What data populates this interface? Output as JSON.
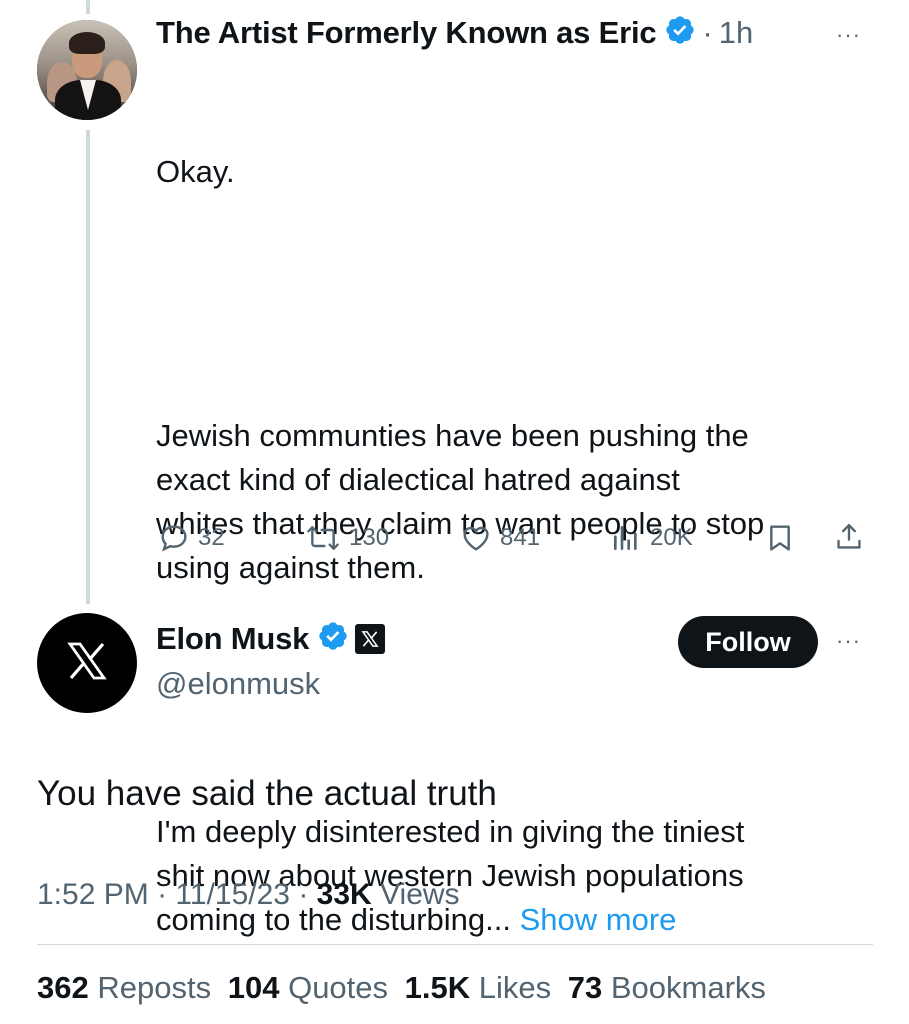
{
  "parent_tweet": {
    "display_name": "The Artist Formerly Known as Eric",
    "time_separator": "·",
    "time": "1h",
    "more_label": "···",
    "text_intro": "Okay.",
    "text_para1": "Jewish communties have been pushing the\nexact kind of dialectical hatred against\nwhites that they claim to want people to stop\nusing against them.",
    "text_para2": "I'm deeply disinterested in giving the tiniest\nshit now about western Jewish populations\ncoming to the disturbing...",
    "show_more": "Show more",
    "actions": {
      "replies": "32",
      "reposts": "130",
      "likes": "841",
      "views": "20K"
    }
  },
  "main_tweet": {
    "display_name": "Elon Musk",
    "handle": "@elonmusk",
    "follow_label": "Follow",
    "more_label": "···",
    "text": "You have said the actual truth",
    "time": "1:52 PM",
    "sep1": "·",
    "date": "11/15/23",
    "sep2": "·",
    "views_count": "33K",
    "views_label": "Views",
    "stats": {
      "reposts_count": "362",
      "reposts_label": "Reposts",
      "quotes_count": "104",
      "quotes_label": "Quotes",
      "likes_count": "1.5K",
      "likes_label": "Likes",
      "bookmarks_count": "73",
      "bookmarks_label": "Bookmarks"
    }
  },
  "colors": {
    "accent_blue": "#1d9bf0",
    "muted": "#536471",
    "text": "#0f1419",
    "thread_line": "#cfd9de"
  },
  "icons": [
    "verified-badge-icon",
    "x-logo-icon",
    "reply-icon",
    "repost-icon",
    "like-icon",
    "views-icon",
    "bookmark-icon",
    "share-icon",
    "more-options-icon"
  ]
}
